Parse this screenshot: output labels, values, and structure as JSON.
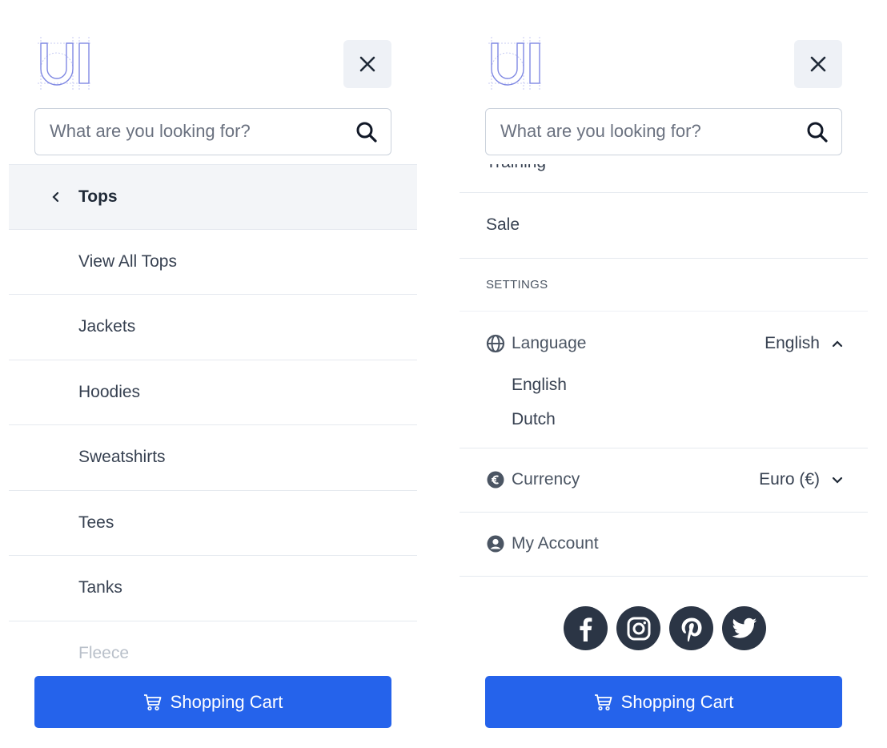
{
  "colors": {
    "primary": "#2563eb",
    "social_bg": "#2b3545",
    "active_row_bg": "#f3f5f8",
    "logo_stroke": "#8b93e6"
  },
  "search": {
    "placeholder": "What are you looking for?"
  },
  "left_panel": {
    "back_label": "Tops",
    "items": [
      {
        "label": "View All Tops"
      },
      {
        "label": "Jackets"
      },
      {
        "label": "Hoodies"
      },
      {
        "label": "Sweatshirts"
      },
      {
        "label": "Tees"
      },
      {
        "label": "Tanks"
      },
      {
        "label": "Fleece"
      }
    ]
  },
  "right_panel": {
    "cut_item": "Training",
    "sale_label": "Sale",
    "settings_heading": "SETTINGS",
    "language": {
      "label": "Language",
      "value": "English",
      "icon": "globe-icon",
      "expanded": true,
      "options": [
        "English",
        "Dutch"
      ]
    },
    "currency": {
      "label": "Currency",
      "value": "Euro (€)",
      "icon": "euro-icon",
      "expanded": false
    },
    "account": {
      "label": "My Account",
      "icon": "user-circle-icon"
    },
    "social": [
      "facebook-icon",
      "instagram-icon",
      "pinterest-icon",
      "twitter-icon"
    ]
  },
  "cart": {
    "label": "Shopping Cart"
  }
}
